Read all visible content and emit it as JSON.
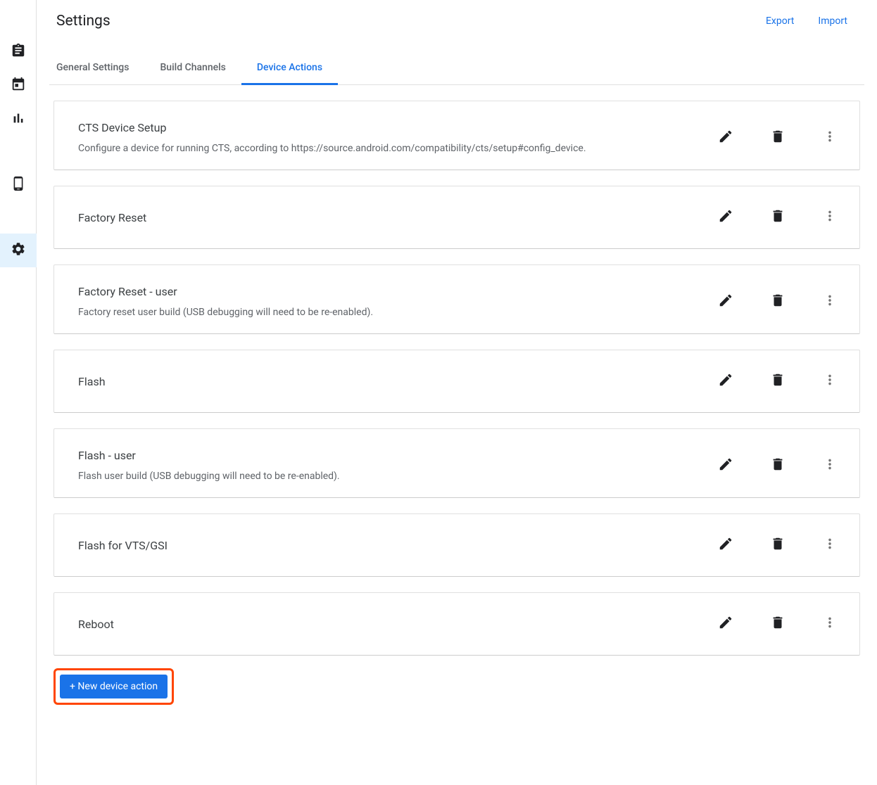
{
  "page_title": "Settings",
  "header_actions": {
    "export": "Export",
    "import": "Import"
  },
  "tabs": [
    {
      "label": "General Settings",
      "active": false
    },
    {
      "label": "Build Channels",
      "active": false
    },
    {
      "label": "Device Actions",
      "active": true
    }
  ],
  "actions": [
    {
      "title": "CTS Device Setup",
      "description": "Configure a device for running CTS, according to https://source.android.com/compatibility/cts/setup#config_device."
    },
    {
      "title": "Factory Reset",
      "description": ""
    },
    {
      "title": "Factory Reset - user",
      "description": "Factory reset user build (USB debugging will need to be re-enabled)."
    },
    {
      "title": "Flash",
      "description": ""
    },
    {
      "title": "Flash - user",
      "description": "Flash user build (USB debugging will need to be re-enabled)."
    },
    {
      "title": "Flash for VTS/GSI",
      "description": ""
    },
    {
      "title": "Reboot",
      "description": ""
    }
  ],
  "new_button_label": "+ New device action",
  "sidenav": {
    "items": [
      "clipboard",
      "calendar",
      "bar-chart",
      "phone",
      "settings"
    ],
    "active": "settings"
  }
}
